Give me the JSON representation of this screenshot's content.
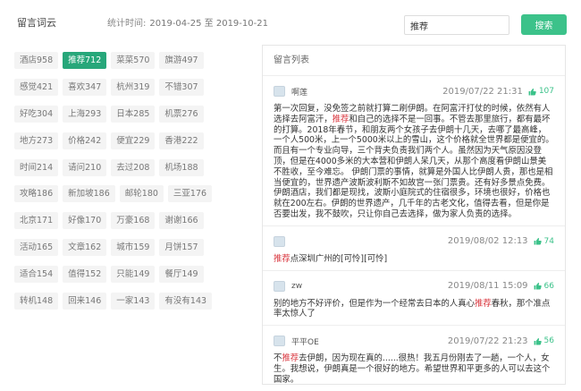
{
  "header": {
    "title": "留言词云",
    "period_label": "统计时间:",
    "period_range": "2019-04-25 至 2019-10-21",
    "search_value": "推荐",
    "search_button": "搜索"
  },
  "tags": [
    [
      "酒店958",
      "推荐712",
      "菜菜570",
      "旗游497"
    ],
    [
      "感觉421",
      "喜欢347",
      "杭州319",
      "不错307"
    ],
    [
      "好吃304",
      "上海293",
      "日本285",
      "机票276"
    ],
    [
      "地方273",
      "价格242",
      "便宜229",
      "香港222"
    ],
    [
      "时间214",
      "请问210",
      "去过208",
      "机场188"
    ],
    [
      "攻略186",
      "新加坡186",
      "邮轮180",
      "三亚176"
    ],
    [
      "北京171",
      "好像170",
      "万豪168",
      "谢谢166"
    ],
    [
      "活动165",
      "文章162",
      "城市159",
      "月饼157"
    ],
    [
      "适合154",
      "值得152",
      "只能149",
      "餐厅149"
    ],
    [
      "转机148",
      "回来146",
      "一家143",
      "有没有143"
    ]
  ],
  "active_tag": "推荐712",
  "panel": {
    "title": "留言列表",
    "comments": [
      {
        "user": "啊莲",
        "time": "2019/07/22 21:31",
        "likes": "107",
        "segments": [
          {
            "t": "第一次回复，没免签之前就打算二刷伊朗。在阿富汗打仗的时候，依然有人选择去阿富汗，"
          },
          {
            "t": "推荐",
            "hl": true
          },
          {
            "t": "和自己的选择不是一回事。不管去那里旅行，都有最坏的打算。2018年春节，和朋友两个女孩子去伊朗十几天，去哪了最高峰，一个人500米，上一个5000米以上的雪山，这个价格就全世界都是便宜的。而且有一个专业向导，三个背夫负责我们两个人。虽然因为天气原因没登顶，但是在4000多米的大本营和伊朗人呆几天，从那个高度看伊朗山景美不胜收，至今难忘。 伊朗门票的事情，就算是外国人比伊朗人贵，那也是相当便宜的，世界遗产波斯波利斯不如故宫一张门票贵。还有好多景点免费。 伊朗酒店，我们都是现找，波斯小庭院式的住宿很多，环境也很好，价格也就在200左右。伊朗的世界遗产，几千年的古老文化，值得去看，但是你是否要出发，我不鼓吹，只让你自己去选择，做为家人负责的选择。"
          }
        ]
      },
      {
        "user": "",
        "time": "2019/08/02 12:13",
        "likes": "74",
        "segments": [
          {
            "t": "推荐",
            "hl": true
          },
          {
            "t": "点深圳广州的[可怜][可怜]"
          }
        ]
      },
      {
        "user": "zw",
        "time": "2019/08/11 15:09",
        "likes": "66",
        "segments": [
          {
            "t": "别的地方不好评价，但是作为一个经常去日本的人真心"
          },
          {
            "t": "推荐",
            "hl": true
          },
          {
            "t": "春秋，那个准点率太惊人了"
          }
        ]
      },
      {
        "user": "平平OE",
        "time": "2019/07/22 21:23",
        "likes": "56",
        "segments": [
          {
            "t": "不"
          },
          {
            "t": "推荐",
            "hl": true
          },
          {
            "t": "去伊朗，因为现在真的......很热！我五月份刚去了一趟，一个人，女生。我想说，伊朗真是一个很好的地方。希望世界和平更多的人可以去这个国家。"
          }
        ]
      }
    ]
  },
  "colors": {
    "accent": "#3cc28a",
    "active_tag": "#27a77a",
    "highlight": "#d9363e"
  }
}
